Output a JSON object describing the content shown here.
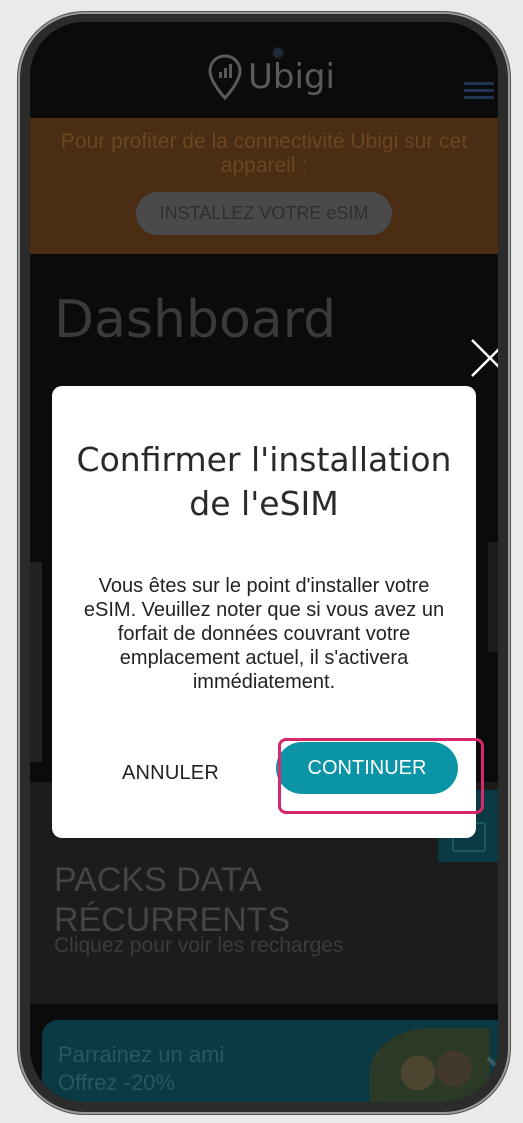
{
  "app": {
    "logo_text": "Ubigi"
  },
  "banner": {
    "text": "Pour profiter de la connectivité Ubigi sur cet appareil :",
    "button_label": "INSTALLEZ VOTRE eSIM"
  },
  "page": {
    "title": "Dashboard"
  },
  "cards": {
    "recurrent_title_line1": "PACKS DATA",
    "recurrent_title_line2": "RÉCURRENTS",
    "recurrent_subtitle": "Cliquez pour voir les recharges",
    "refer_line1": "Parrainez un ami",
    "refer_line2": "Offrez -20%"
  },
  "modal": {
    "title": "Confirmer l'installation de l'eSIM",
    "body": "Vous êtes sur le point d'installer votre eSIM. Veuillez noter que si vous avez un forfait de données couvrant votre emplacement actuel, il s'activera immédiatement.",
    "cancel_label": "ANNULER",
    "continue_label": "CONTINUER"
  },
  "colors": {
    "accent": "#0b93a6",
    "highlight": "#d8286d",
    "banner": "#4a2d12"
  },
  "icons": [
    "ubigi-pin-icon",
    "menu-icon",
    "close-icon",
    "chevron-right-icon",
    "card-icon"
  ]
}
